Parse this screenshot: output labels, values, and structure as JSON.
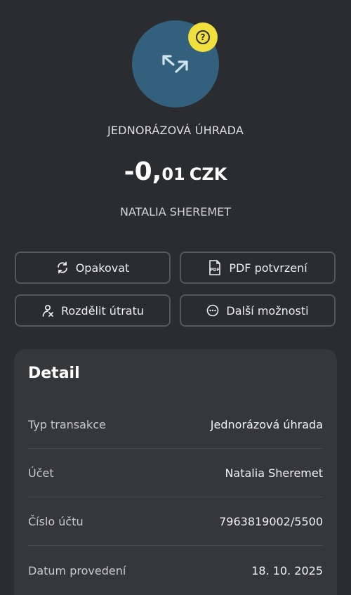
{
  "header": {
    "help_icon": "question-circle-icon",
    "avatar_icon": "transfer-arrows-icon",
    "transaction_type": "JEDNORÁZOVÁ ÚHRADA",
    "amount_main": "-0,",
    "amount_decimal": "01",
    "currency": "CZK",
    "counterparty": "NATALIA SHEREMET"
  },
  "actions": {
    "repeat": {
      "label": "Opakovat",
      "icon": "refresh-icon"
    },
    "pdf": {
      "label": "PDF potvrzení",
      "icon": "pdf-document-icon"
    },
    "split": {
      "label": "Rozdělit útratu",
      "icon": "split-people-icon"
    },
    "more": {
      "label": "Další možnosti",
      "icon": "more-dots-icon"
    }
  },
  "detail": {
    "title": "Detail",
    "rows": [
      {
        "label": "Typ transakce",
        "value": "Jednorázová úhrada"
      },
      {
        "label": "Účet",
        "value": "Natalia Sheremet"
      },
      {
        "label": "Číslo účtu",
        "value": "7963819002/5500"
      },
      {
        "label": "Datum provedení",
        "value": "18. 10. 2025"
      }
    ]
  },
  "colors": {
    "background": "#2b2c30",
    "avatar": "#33607c",
    "badge": "#f0df3c",
    "card": "#36373b"
  }
}
